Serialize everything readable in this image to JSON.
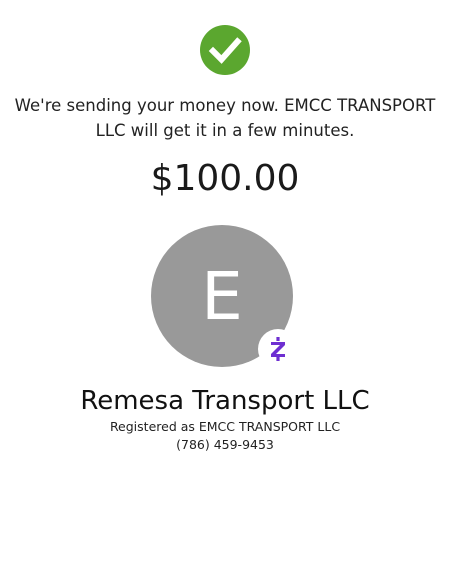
{
  "status": {
    "icon": "checkmark-circle-icon",
    "color": "#5ba72f",
    "message_line1": "We're sending your money now. EMCC TRANSPORT",
    "message_line2": "LLC will get it in a few minutes."
  },
  "payment": {
    "amount": "$100.00"
  },
  "recipient": {
    "avatar_initial": "E",
    "avatar_color": "#999999",
    "badge_icon": "cash-app-z-icon",
    "badge_color": "#6e2fd1",
    "display_name": "Remesa Transport LLC",
    "registered_as": "Registered as EMCC TRANSPORT LLC",
    "phone": "(786) 459-9453"
  }
}
